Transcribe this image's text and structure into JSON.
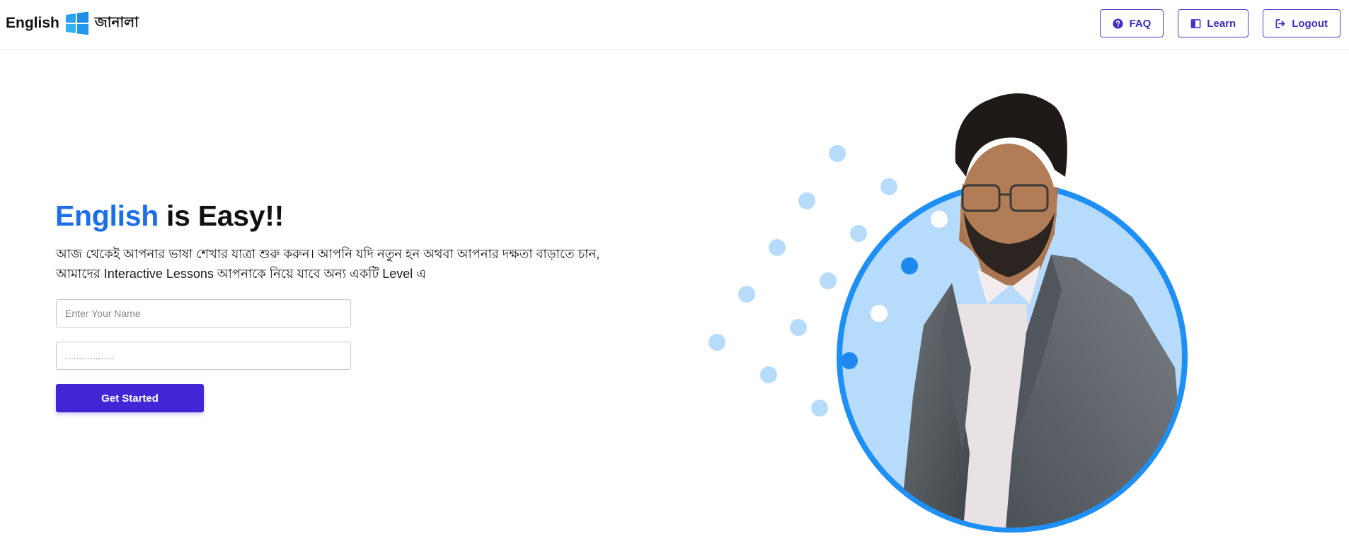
{
  "header": {
    "brand_text": "English",
    "brand_bn": "জানালা",
    "nav": [
      {
        "label": "FAQ",
        "icon": "question-circle-icon"
      },
      {
        "label": "Learn",
        "icon": "book-icon"
      },
      {
        "label": "Logout",
        "icon": "logout-icon"
      }
    ]
  },
  "hero": {
    "title_accent": "English",
    "title_rest": " is Easy!!",
    "description": "আজ থেকেই আপনার ভাষা শেখার যাত্রা শুরু করুন। আপনি যদি নতুন হন অথবা আপনার দক্ষতা বাড়াতে চান, আমাদের Interactive Lessons আপনাকে নিয়ে যাবে অন্য একটি Level এ",
    "name_placeholder": "Enter Your Name",
    "password_placeholder": "..................",
    "cta_label": "Get Started"
  },
  "colors": {
    "accent": "#1c6fe6",
    "primary_button": "#4126d6",
    "nav_border": "#4a3fcf",
    "ring": "#1e90f5",
    "circle_fill": "#b7dcfb",
    "dot_light": "#b7dcfb",
    "dot_dark": "#1e88ee"
  }
}
